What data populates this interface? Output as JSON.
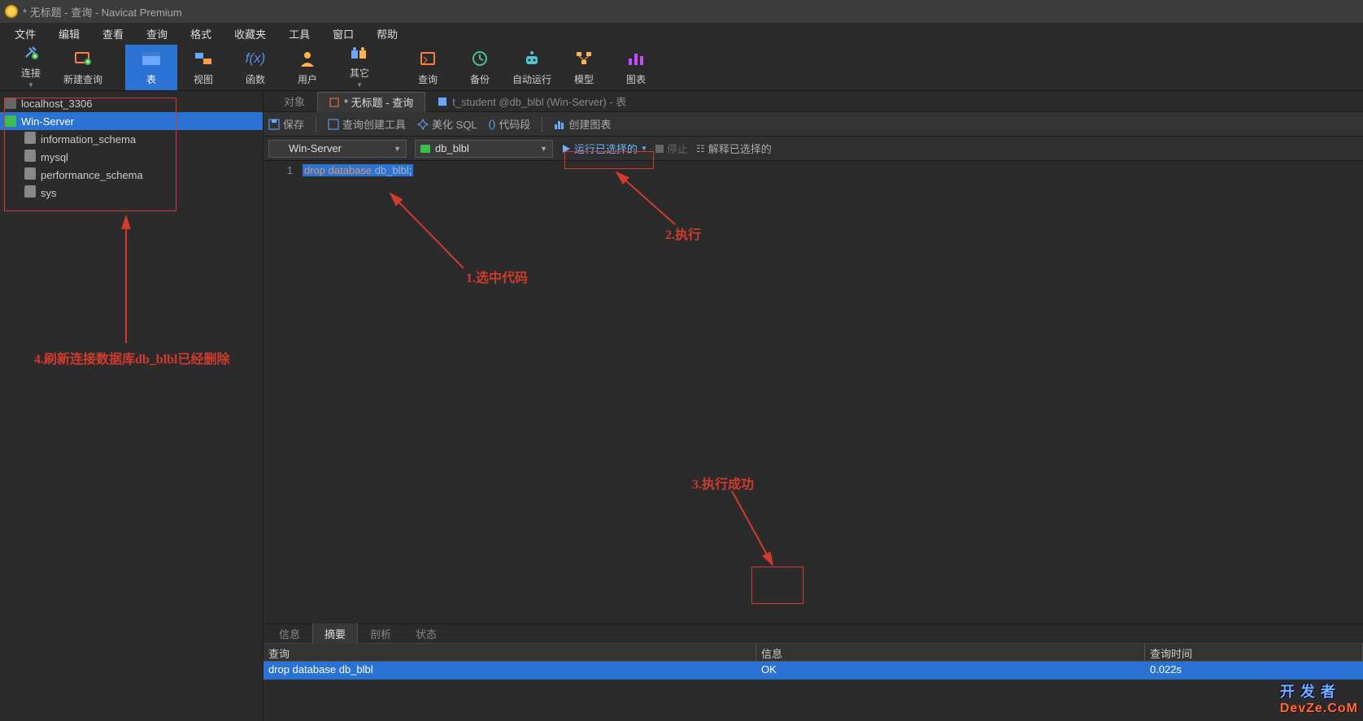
{
  "titlebar": {
    "title": "* 无标题 - 查询 - Navicat Premium"
  },
  "menu": {
    "items": [
      "文件",
      "编辑",
      "查看",
      "查询",
      "格式",
      "收藏夹",
      "工具",
      "窗口",
      "帮助"
    ]
  },
  "toolbar": {
    "items": [
      {
        "label": "连接",
        "icon": "plug"
      },
      {
        "label": "新建查询",
        "icon": "newquery"
      },
      {
        "label": "表",
        "icon": "table",
        "active": true
      },
      {
        "label": "视图",
        "icon": "view"
      },
      {
        "label": "函数",
        "icon": "fx"
      },
      {
        "label": "用户",
        "icon": "user"
      },
      {
        "label": "其它",
        "icon": "other"
      },
      {
        "label": "查询",
        "icon": "query"
      },
      {
        "label": "备份",
        "icon": "backup"
      },
      {
        "label": "自动运行",
        "icon": "robot"
      },
      {
        "label": "模型",
        "icon": "model"
      },
      {
        "label": "图表",
        "icon": "chart"
      }
    ]
  },
  "sidebar": {
    "connections": [
      {
        "name": "localhost_3306",
        "selected": false,
        "open": false
      },
      {
        "name": "Win-Server",
        "selected": true,
        "open": true,
        "databases": [
          "information_schema",
          "mysql",
          "performance_schema",
          "sys"
        ]
      }
    ]
  },
  "doctabs": {
    "items": [
      {
        "label": "对象",
        "active": false
      },
      {
        "label": "* 无标题 - 查询",
        "active": true
      },
      {
        "label": "t_student @db_blbl (Win-Server) - 表",
        "active": false
      }
    ]
  },
  "qtoolbar": {
    "save": "保存",
    "builder": "查询创建工具",
    "beautify": "美化 SQL",
    "snippet": "代码段",
    "chart": "创建图表"
  },
  "runbar": {
    "connection": "Win-Server",
    "database": "db_blbl",
    "run_selected": "运行已选择的",
    "stop": "停止",
    "explain_selected": "解释已选择的"
  },
  "editor": {
    "line_number": "1",
    "sql_keyword1": "drop",
    "sql_keyword2": "database",
    "sql_ident": "db_blbl",
    "sql_semi": ";"
  },
  "result_tabs": {
    "items": [
      "信息",
      "摘要",
      "剖析",
      "状态"
    ],
    "active": 1
  },
  "result_headers": {
    "query": "查询",
    "info": "信息",
    "time": "查询时间"
  },
  "result_row": {
    "query": "drop database db_blbl",
    "info": "OK",
    "time": "0.022s"
  },
  "annotations": {
    "a1": "1.选中代码",
    "a2": "2.执行",
    "a3": "3.执行成功",
    "a4": "4.刷新连接数据库db_blbl已经删除"
  },
  "watermark": {
    "line1": "开 发 者",
    "line2": "DevZe.CoM"
  }
}
